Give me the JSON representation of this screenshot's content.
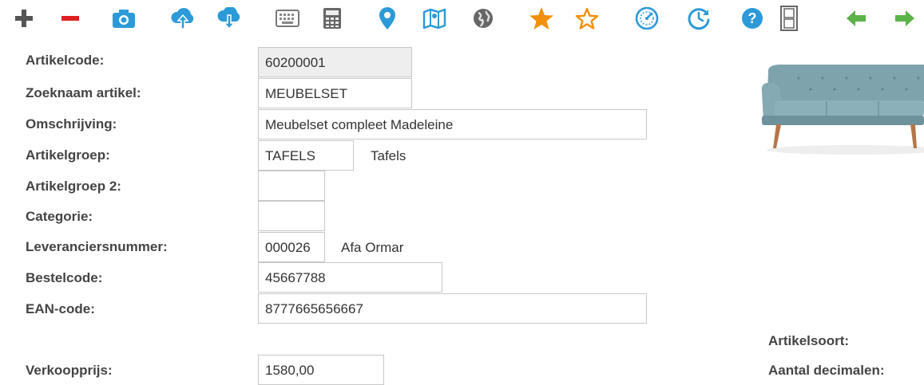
{
  "toolbar": {
    "icons": [
      "plus-icon",
      "minus-icon",
      "camera-icon",
      "cloud-upload-icon",
      "cloud-download-icon",
      "keyboard-icon",
      "calculator-icon",
      "map-pin-icon",
      "map-icon",
      "globe-icon",
      "star-filled-icon",
      "star-outline-icon",
      "speedometer-icon",
      "clock-refresh-icon",
      "help-icon",
      "film-icon",
      "arrow-left-icon",
      "arrow-right-icon"
    ],
    "colors": {
      "gray": "#555555",
      "red": "#e02020",
      "blue": "#2c9ad8",
      "orange": "#f0900c",
      "green": "#5bb34a"
    }
  },
  "form": {
    "artikelcode": {
      "label": "Artikelcode:",
      "value": "60200001"
    },
    "zoeknaam": {
      "label": "Zoeknaam artikel:",
      "value": "MEUBELSET"
    },
    "omschrijving": {
      "label": "Omschrijving:",
      "value": "Meubelset compleet Madeleine"
    },
    "artikelgroep": {
      "label": "Artikelgroep:",
      "value": "TAFELS",
      "description": "Tafels"
    },
    "artikelgroep2": {
      "label": "Artikelgroep 2:",
      "value": ""
    },
    "categorie": {
      "label": "Categorie:",
      "value": ""
    },
    "leverancier": {
      "label": "Leveranciersnummer:",
      "value": "000026",
      "description": "Afa Ormar"
    },
    "bestelcode": {
      "label": "Bestelcode:",
      "value": "45667788"
    },
    "ean": {
      "label": "EAN-code:",
      "value": "8777665656667"
    },
    "verkoopprijs": {
      "label": "Verkoopprijs:",
      "value": "1580,00"
    }
  },
  "right": {
    "artikelsoort_label": "Artikelsoort:",
    "aantal_decimalen_label": "Aantal decimalen:"
  }
}
